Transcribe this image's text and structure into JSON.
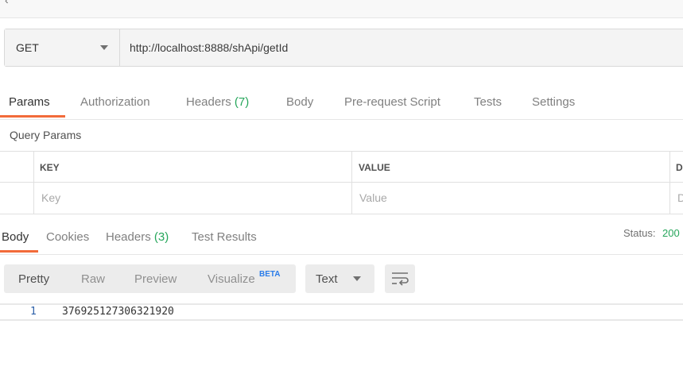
{
  "request": {
    "method": "GET",
    "url": "http://localhost:8888/shApi/getId"
  },
  "request_tabs": [
    {
      "label": "Params",
      "active": true
    },
    {
      "label": "Authorization"
    },
    {
      "label": "Headers",
      "count": "(7)"
    },
    {
      "label": "Body"
    },
    {
      "label": "Pre-request Script"
    },
    {
      "label": "Tests"
    },
    {
      "label": "Settings"
    }
  ],
  "query_params": {
    "title": "Query Params",
    "columns": [
      "KEY",
      "VALUE",
      "D"
    ],
    "placeholders": {
      "key": "Key",
      "value": "Value",
      "description": "D"
    }
  },
  "response_tabs": [
    {
      "label": "Body",
      "active": true
    },
    {
      "label": "Cookies"
    },
    {
      "label": "Headers",
      "count": "(3)"
    },
    {
      "label": "Test Results"
    }
  ],
  "status": {
    "label": "Status:",
    "value": "200"
  },
  "view_modes": [
    "Pretty",
    "Raw",
    "Preview",
    "Visualize"
  ],
  "beta_label": "BETA",
  "format": "Text",
  "icons": {
    "method_caret": "chevron-down-icon",
    "format_caret": "chevron-down-icon",
    "wrap": "wrap-lines-icon"
  },
  "colors": {
    "accent": "#f26b3a",
    "count": "#26a65b",
    "beta": "#2b7de9"
  },
  "body_lines": [
    {
      "number": "1",
      "text": "376925127306321920"
    }
  ]
}
